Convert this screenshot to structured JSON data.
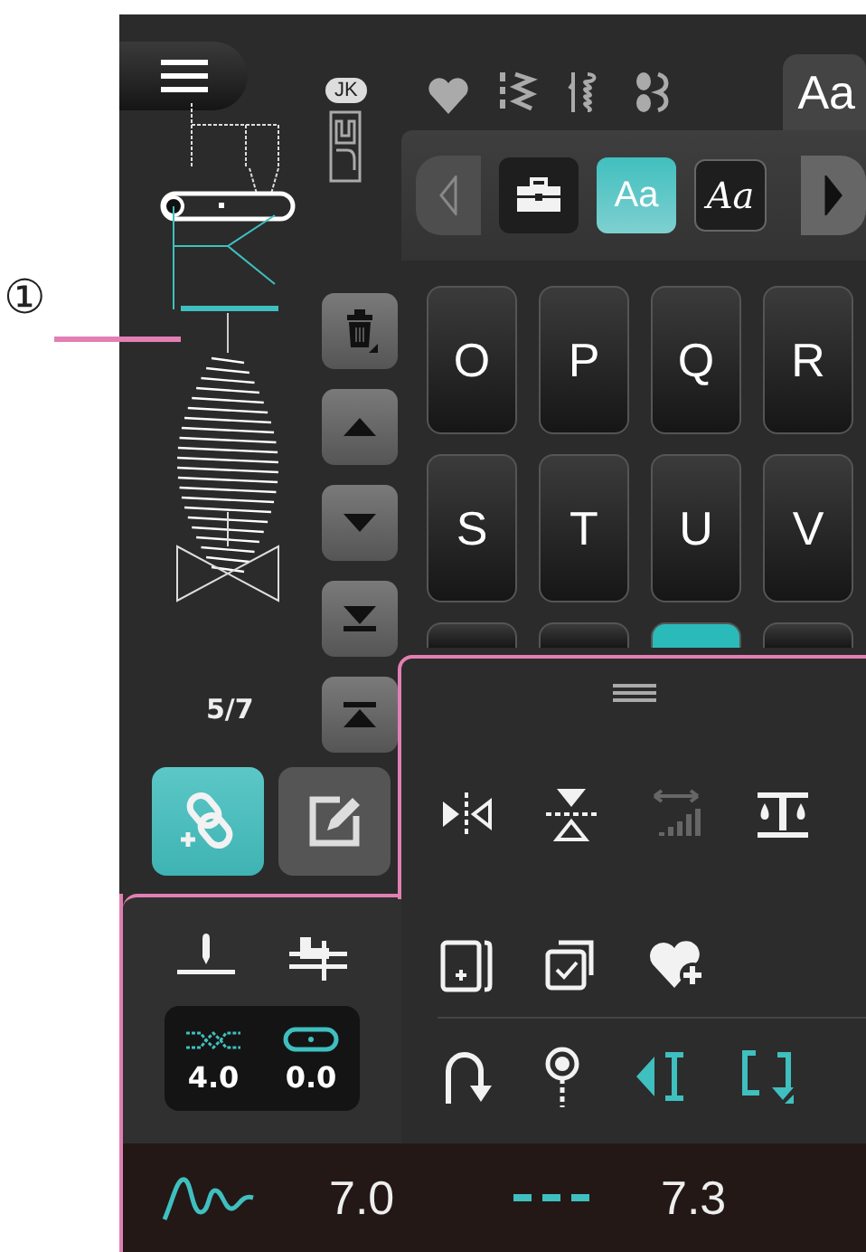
{
  "callout": {
    "label": "①"
  },
  "presser_foot": {
    "label": "JK"
  },
  "stitch_counter": "5/7",
  "side_buttons": [
    {
      "kind": "delete"
    },
    {
      "kind": "up"
    },
    {
      "kind": "down"
    },
    {
      "kind": "last"
    },
    {
      "kind": "first"
    }
  ],
  "mode_buttons": [
    {
      "kind": "link",
      "selected": true
    },
    {
      "kind": "edit",
      "selected": false
    }
  ],
  "tabs": [
    {
      "kind": "heart",
      "selected": false
    },
    {
      "kind": "utility",
      "selected": false
    },
    {
      "kind": "satin",
      "selected": false
    },
    {
      "kind": "buttonhole",
      "selected": false
    },
    {
      "kind": "text",
      "label": "Aa",
      "selected": true
    }
  ],
  "font_bar": [
    {
      "kind": "prev",
      "disabled": true
    },
    {
      "kind": "toolbox",
      "selected": false
    },
    {
      "kind": "block",
      "label": "Aa",
      "selected": true
    },
    {
      "kind": "script",
      "label": "Aa",
      "selected": false
    },
    {
      "kind": "next",
      "disabled": false
    }
  ],
  "letters": [
    {
      "label": "O",
      "selected": false
    },
    {
      "label": "P",
      "selected": false
    },
    {
      "label": "Q",
      "selected": false
    },
    {
      "label": "R",
      "selected": false
    },
    {
      "label": "S",
      "selected": false
    },
    {
      "label": "T",
      "selected": false
    },
    {
      "label": "U",
      "selected": false
    },
    {
      "label": "V",
      "selected": false
    },
    {
      "selected": false
    },
    {
      "selected": false
    },
    {
      "selected": true
    },
    {
      "selected": false
    }
  ],
  "edit_panel": {
    "left_tools": [
      {
        "kind": "needle-stop"
      },
      {
        "kind": "presser-foot"
      }
    ],
    "settings": [
      {
        "kind": "tension",
        "value": "4.0"
      },
      {
        "kind": "position",
        "value": "0.0"
      }
    ],
    "tool_rows": [
      [
        {
          "kind": "mirror-side",
          "on": false,
          "disabled": false
        },
        {
          "kind": "mirror-vertical",
          "on": false,
          "disabled": false
        },
        {
          "kind": "density",
          "on": false,
          "disabled": true
        },
        {
          "kind": "balance",
          "on": false,
          "disabled": false
        }
      ],
      [
        {
          "kind": "add-page",
          "on": false,
          "disabled": false
        },
        {
          "kind": "select-all",
          "on": false,
          "disabled": false
        },
        {
          "kind": "favorite-add",
          "on": false,
          "disabled": false
        }
      ],
      [
        {
          "kind": "reverse",
          "on": false,
          "disabled": false
        },
        {
          "kind": "tie-off",
          "on": false,
          "disabled": false
        },
        {
          "kind": "start-point",
          "on": true,
          "disabled": false
        },
        {
          "kind": "repeat",
          "on": true,
          "disabled": false
        }
      ]
    ]
  },
  "status_bar": [
    {
      "kind": "width",
      "value": "7.0"
    },
    {
      "kind": "length",
      "value": "7.3"
    }
  ]
}
